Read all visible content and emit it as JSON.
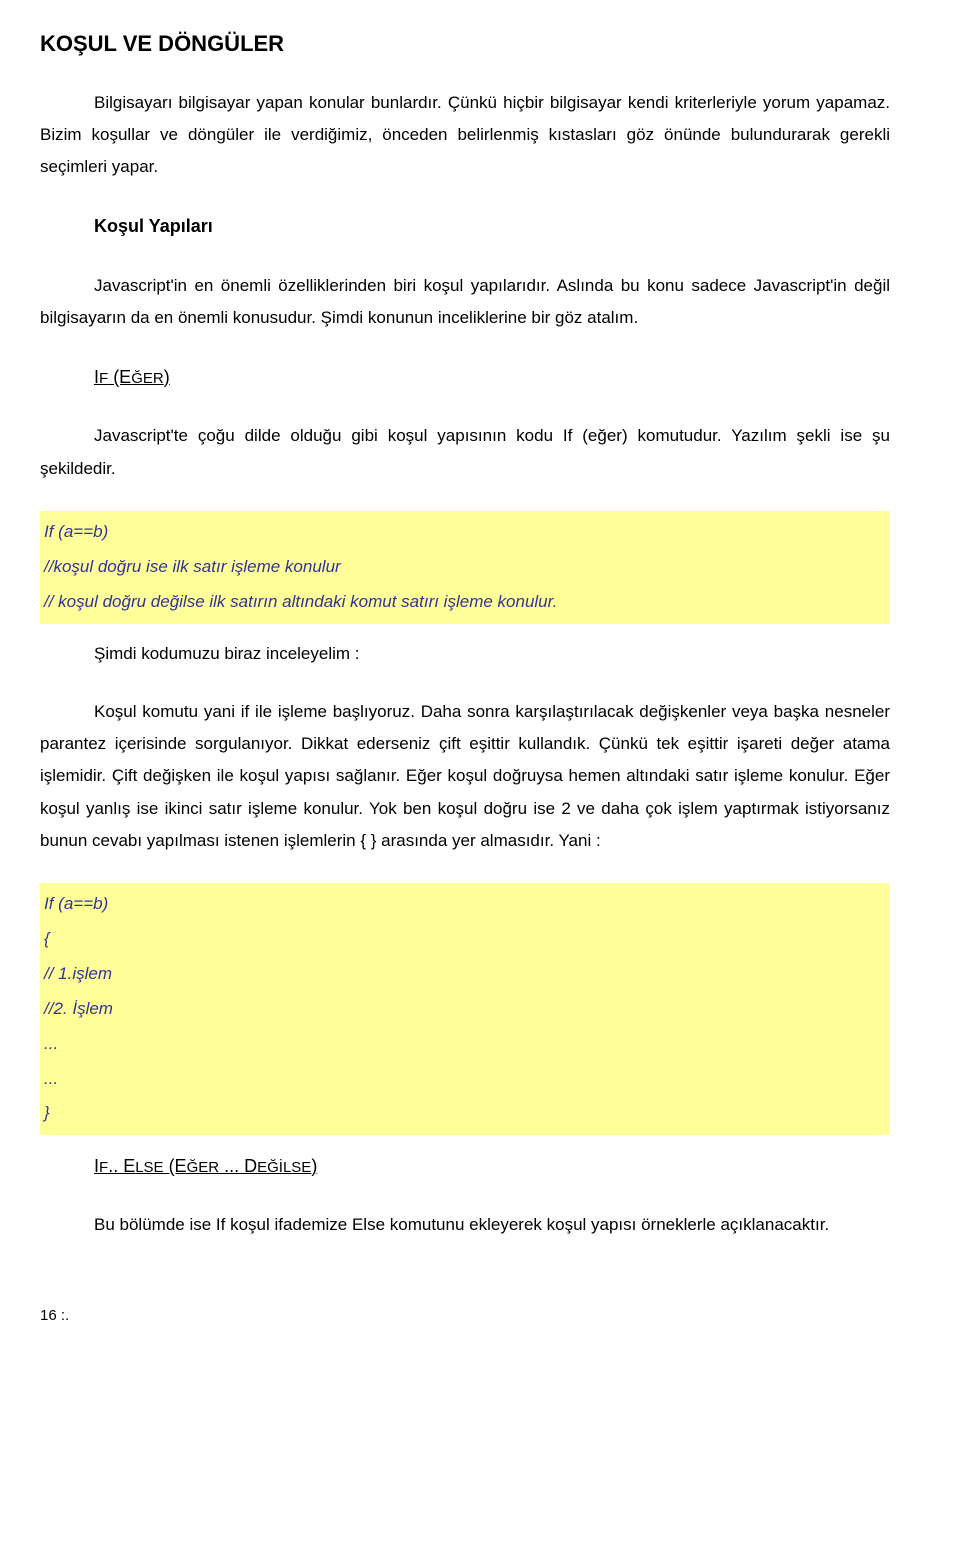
{
  "heading": "KOŞUL VE DÖNGÜLER",
  "para1": "Bilgisayarı bilgisayar yapan konular bunlardır. Çünkü hiçbir bilgisayar kendi kriterleriyle yorum yapamaz. Bizim koşullar ve döngüler ile verdiğimiz, önceden belirlenmiş kıstasları göz önünde bulundurarak gerekli seçimleri yapar.",
  "subheading1": "Koşul Yapıları",
  "para2": "Javascript'in en önemli özelliklerinden biri koşul yapılarıdır. Aslında bu konu sadece Javascript'in değil bilgisayarın da en önemli konusudur. Şimdi konunun inceliklerine bir göz atalım.",
  "ifHeading": {
    "prefix": "I",
    "f": "F",
    "open": " (E",
    "ger": "ĞER",
    "close": ")"
  },
  "para3": "Javascript'te çoğu dilde olduğu gibi koşul yapısının kodu If (eğer) komutudur. Yazılım şekli ise şu şekildedir.",
  "code1": {
    "l1": "If (a==b)",
    "l2": "//koşul doğru ise ilk satır işleme konulur",
    "l3": "// koşul doğru değilse ilk satırın altındaki komut satırı işleme konulur."
  },
  "afterCode1": "Şimdi kodumuzu biraz inceleyelim :",
  "para4": "Koşul komutu yani if ile işleme başlıyoruz. Daha sonra karşılaştırılacak değişkenler veya başka nesneler parantez içerisinde sorgulanıyor. Dikkat ederseniz çift eşittir kullandık. Çünkü tek eşittir işareti değer atama işlemidir. Çift değişken ile koşul yapısı sağlanır. Eğer koşul doğruysa hemen altındaki satır işleme konulur. Eğer koşul yanlış ise ikinci satır işleme konulur. Yok ben koşul doğru ise 2 ve daha çok işlem yaptırmak istiyorsanız bunun cevabı yapılması istenen işlemlerin { } arasında yer almasıdır. Yani :",
  "code2": {
    "l1": "If (a==b)",
    "l2": "{",
    "l3": "// 1.işlem",
    "l4": "//2. İşlem",
    "l5": "...",
    "l6": "...",
    "l7": "}"
  },
  "ifElseHeading": {
    "p1": "I",
    "p2": "F",
    "p3": ".. E",
    "p4": "LSE",
    "p5": " (E",
    "p6": "ĞER",
    "p7": " ... D",
    "p8": "EĞİLSE",
    "p9": ")"
  },
  "para5": "Bu bölümde ise If koşul ifademize Else komutunu ekleyerek koşul yapısı örneklerle açıklanacaktır.",
  "footer": "16 :."
}
